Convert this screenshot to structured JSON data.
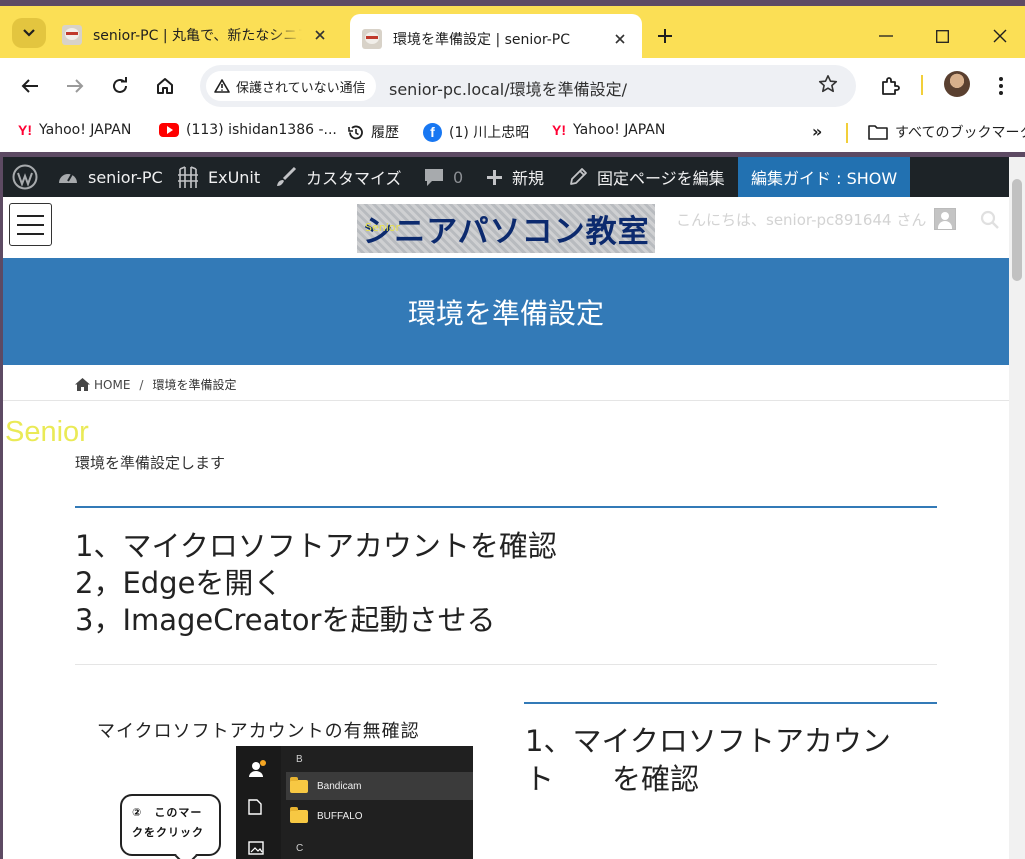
{
  "browser": {
    "tabs": [
      {
        "title": "senior-PC | 丸亀で、新たなシニアの",
        "active": false
      },
      {
        "title": "環境を準備設定 | senior-PC",
        "active": true
      }
    ],
    "security_chip": "保護されていない通信",
    "url": "senior-pc.local/環境を準備設定/",
    "bookmarks": [
      {
        "label": "Yahoo! JAPAN",
        "icon": "yahoo-japan-icon"
      },
      {
        "label": "(113) ishidan1386 -...",
        "icon": "youtube-icon"
      },
      {
        "label": "履歴",
        "icon": "history-icon"
      },
      {
        "label": "(1) 川上忠昭",
        "icon": "facebook-icon"
      },
      {
        "label": "Yahoo! JAPAN",
        "icon": "yahoo-japan-icon"
      }
    ],
    "yahoo_mark": "Y!",
    "facebook_mark": "f",
    "bookmarks_overflow": "»",
    "all_bookmarks": "すべてのブックマーク"
  },
  "adminbar": {
    "site": "senior-PC",
    "exunit": "ExUnit",
    "customize": "カスタマイズ",
    "comments": "0",
    "new": "新規",
    "edit": "固定ページを編集",
    "guide": "編集ガイド : SHOW"
  },
  "site": {
    "logo": "シニアパソコン教室",
    "logo_small": "Senior",
    "greeting": "こんにちは、senior-pc891644 さん"
  },
  "page": {
    "title": "環境を準備設定",
    "breadcrumb_home": "HOME",
    "breadcrumb_current": "環境を準備設定",
    "breadcrumb_sep": "/",
    "senior_text": "Senior",
    "intro": "環境を準備設定します",
    "steps": [
      "1、マイクロソフトアカウントを確認",
      "2，Edgeを開く",
      "3，ImageCreatorを起動させる"
    ],
    "figure": {
      "caption": "マイクロソフトアカウントの有無確認",
      "letter_b": "B",
      "letter_c": "C",
      "rows": [
        "Bandicam",
        "BUFFALO"
      ],
      "bubble_line1": "②　このマー",
      "bubble_line2": "クをクリック"
    },
    "section_heading": "1、マイクロソフトアカウン ト　　を確認"
  },
  "colors": {
    "tabstrip": "#fbdf55",
    "adminbar": "#1d2327",
    "accent_blue": "#337ab7",
    "guide_blue": "#2271b1"
  }
}
